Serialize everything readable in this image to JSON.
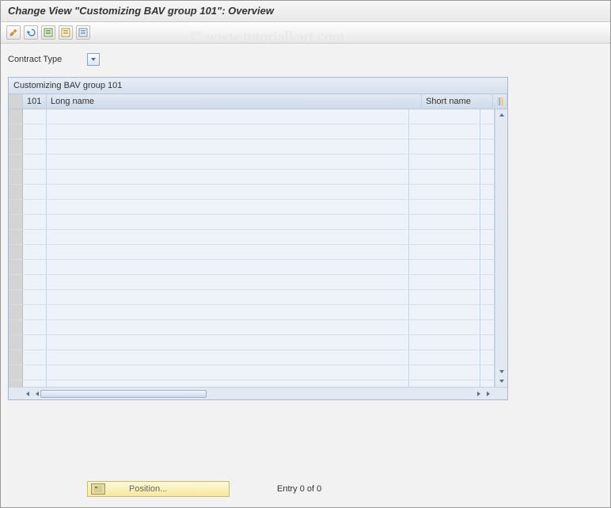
{
  "title": "Change View \"Customizing BAV group 101\": Overview",
  "watermark": "© www.tutorialkart.com",
  "filter": {
    "label": "Contract Type"
  },
  "table": {
    "title": "Customizing BAV group 101",
    "columns": {
      "col1": "101",
      "col2": "Long name",
      "col3": "Short name"
    },
    "rowCount": 19
  },
  "footer": {
    "positionLabel": "Position...",
    "status": "Entry 0 of 0"
  }
}
